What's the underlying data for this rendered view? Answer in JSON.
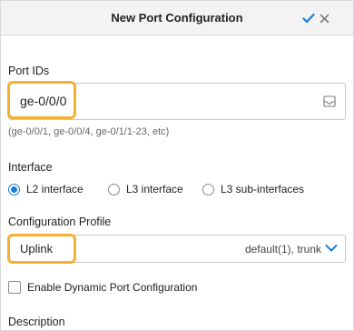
{
  "dialog": {
    "title": "New Port Configuration",
    "confirm_icon": "checkmark-icon",
    "close_icon": "close-icon",
    "accent_color": "#1a7fd6",
    "highlight_color": "#f5b030"
  },
  "port_ids": {
    "label": "Port IDs",
    "value": "ge-0/0/0",
    "hint": "(ge-0/0/1, ge-0/0/4, ge-0/1/1-23, etc)",
    "field_icon": "inbox-tray-icon"
  },
  "interface": {
    "label": "Interface",
    "options": [
      {
        "label": "L2 interface",
        "selected": true
      },
      {
        "label": "L3 interface",
        "selected": false
      },
      {
        "label": "L3 sub-interfaces",
        "selected": false
      }
    ]
  },
  "configuration_profile": {
    "label": "Configuration Profile",
    "value": "Uplink",
    "details": "default(1), trunk",
    "dropdown_icon": "chevron-down-icon"
  },
  "dynamic_port": {
    "label": "Enable Dynamic Port Configuration",
    "checked": false
  },
  "description": {
    "label": "Description"
  }
}
